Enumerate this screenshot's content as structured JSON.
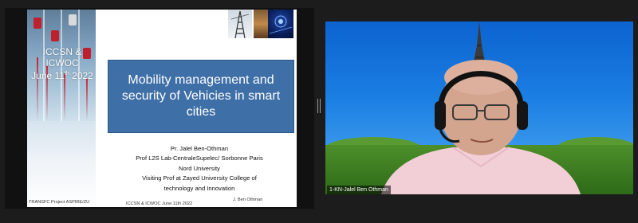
{
  "slide": {
    "conference_title": "ICCSN & ICWOC",
    "conference_date_prefix": "June 11",
    "conference_date_sup": "th",
    "conference_date_year": " 2022",
    "main_title": "Mobility management and security of Vehicies in smart cities",
    "author_lines": [
      "Pr. Jalel Ben-Othman",
      "Prof L2S Lab-CentraleSupelec/ Sorbonne Paris",
      "Nord University",
      "Visiting Prof at Zayed University College of",
      "technology and Innovation"
    ],
    "footer_project": "TRANSFC Project ASPIRE/ZU",
    "footer_conference": "ICCSN & ICWOC June 11th 2022",
    "footer_author": "J. Ben Othman"
  },
  "participant": {
    "name": "1-KN-Jalel Ben Othman"
  },
  "colors": {
    "title_box": "#3f6fa7",
    "sky": "#1b7fe3",
    "background": "#1c1c1c"
  }
}
